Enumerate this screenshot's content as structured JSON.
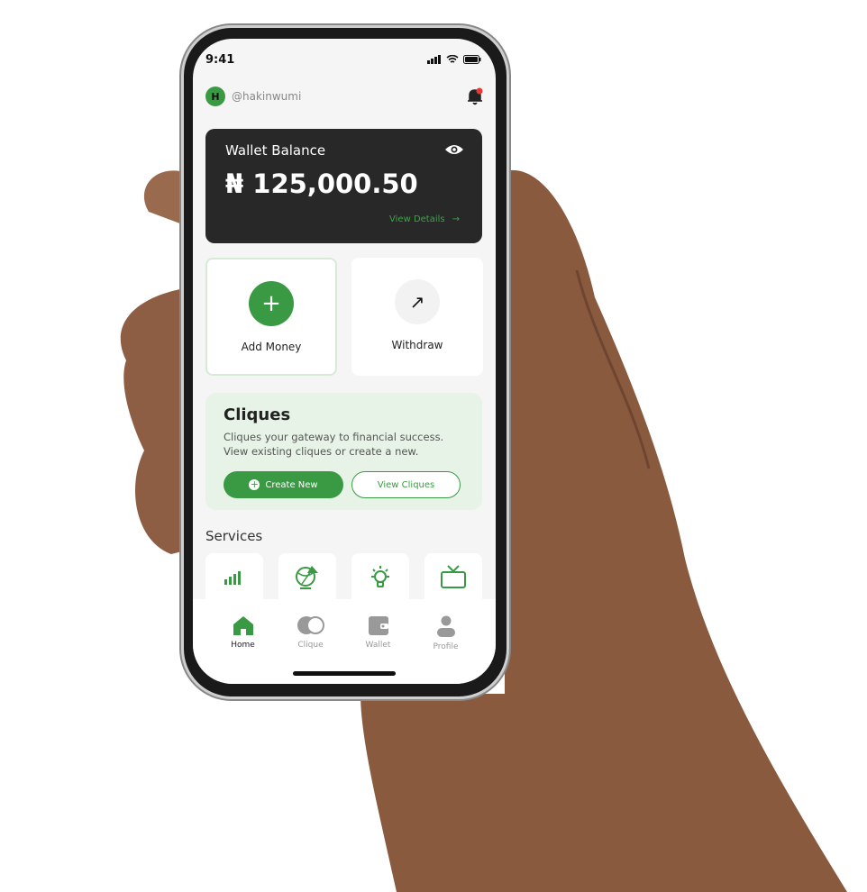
{
  "status": {
    "time": "9:41"
  },
  "header": {
    "avatar_initial": "H",
    "username": "@hakinwumi"
  },
  "wallet": {
    "label": "Wallet Balance",
    "amount": "₦ 125,000.50",
    "view_details": "View Details"
  },
  "actions": {
    "add_money": "Add Money",
    "withdraw": "Withdraw"
  },
  "cliques": {
    "title": "Cliques",
    "description": "Cliques your gateway to financial success. View existing cliques or create a new.",
    "create_new": "Create New",
    "view_cliques": "View Cliques"
  },
  "services": {
    "title": "Services",
    "items": [
      "signal-icon",
      "globe-data-icon",
      "bulb-icon",
      "tv-icon"
    ]
  },
  "nav": {
    "items": [
      "Home",
      "Clique",
      "Wallet",
      "Profile"
    ],
    "active": "Home"
  },
  "colors": {
    "accent": "#3a9a44",
    "dark": "#282828",
    "light_green": "#e6f3e6"
  }
}
